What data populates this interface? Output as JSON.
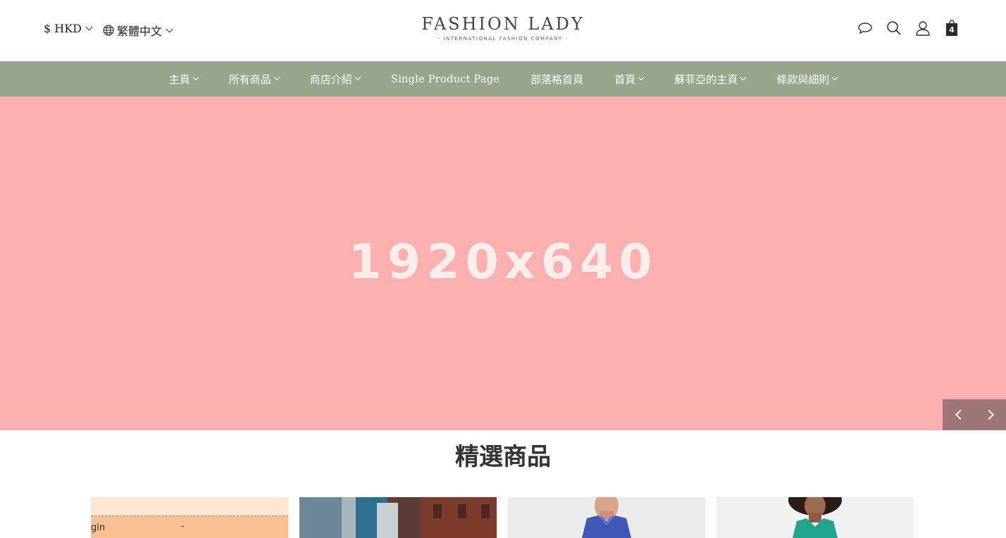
{
  "header": {
    "currency_label": "$ HKD",
    "language_label": "繁體中文",
    "logo_title": "FASHION LADY",
    "logo_subtitle": "- INTERNATIONAL FASHION COMPANY -",
    "cart_count": "4"
  },
  "nav": {
    "items": [
      {
        "label": "主頁",
        "dropdown": true
      },
      {
        "label": "所有商品",
        "dropdown": true
      },
      {
        "label": "商店介紹",
        "dropdown": true
      },
      {
        "label": "Single Product Page",
        "dropdown": false
      },
      {
        "label": "部落格首頁",
        "dropdown": false
      },
      {
        "label": "首頁",
        "dropdown": true
      },
      {
        "label": "蘇菲亞的主頁",
        "dropdown": true
      },
      {
        "label": "條款與細則",
        "dropdown": true
      }
    ]
  },
  "hero": {
    "placeholder_text": "1920x640",
    "background_color": "#fdb0b0"
  },
  "featured": {
    "title": "精選商品"
  },
  "products": [
    {
      "partial_text": "gin",
      "partial_dash": "-"
    },
    {},
    {},
    {}
  ],
  "colors": {
    "nav_background": "#97a58c",
    "hero_background": "#fdb0b0",
    "carousel_controls": "#9e7677"
  }
}
